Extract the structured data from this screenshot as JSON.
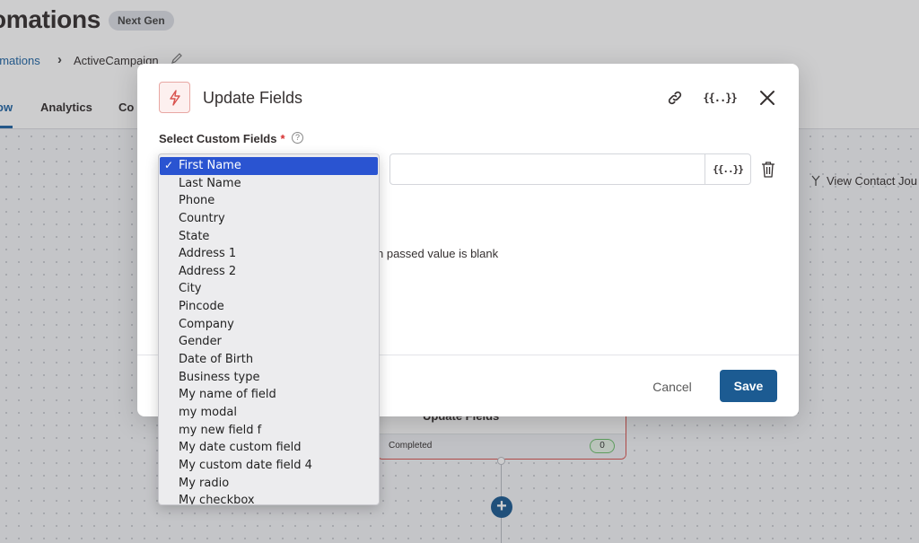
{
  "background": {
    "title": "omations",
    "badge": "Next Gen",
    "breadcrumb": {
      "link": "omations",
      "separator": "›",
      "current": "ActiveCampaign"
    },
    "tabs": [
      {
        "label": "ow"
      },
      {
        "label": "Analytics"
      },
      {
        "label": "Co"
      }
    ],
    "view_journey": "View Contact Jou",
    "node": {
      "title": "Update Fields",
      "status": "Completed",
      "count": "0"
    }
  },
  "modal": {
    "title": "Update Fields",
    "field_label": "Select Custom Fields",
    "required_mark": "*",
    "help_glyph": "?",
    "merge_tag_glyph": "{{..}}",
    "blank_text": "n passed value is blank",
    "cancel_label": "Cancel",
    "save_label": "Save",
    "icons": {
      "header": "lightning-icon",
      "link": "link-icon",
      "merge": "merge-tags-icon",
      "close": "close-icon",
      "trash": "trash-icon"
    },
    "accent": "#1c5b92"
  },
  "dropdown": {
    "check_glyph": "✓",
    "options": [
      "First Name",
      "Last Name",
      "Phone",
      "Country",
      "State",
      "Address 1",
      "Address 2",
      "City",
      "Pincode",
      "Company",
      "Gender",
      "Date of Birth",
      "Business type",
      "My name of field",
      "my modal",
      "my new field f",
      "My date custom field",
      "My custom date field 4",
      "My radio",
      "My checkbox"
    ],
    "selected_index": 0,
    "selected_color": "#2a54d1"
  }
}
